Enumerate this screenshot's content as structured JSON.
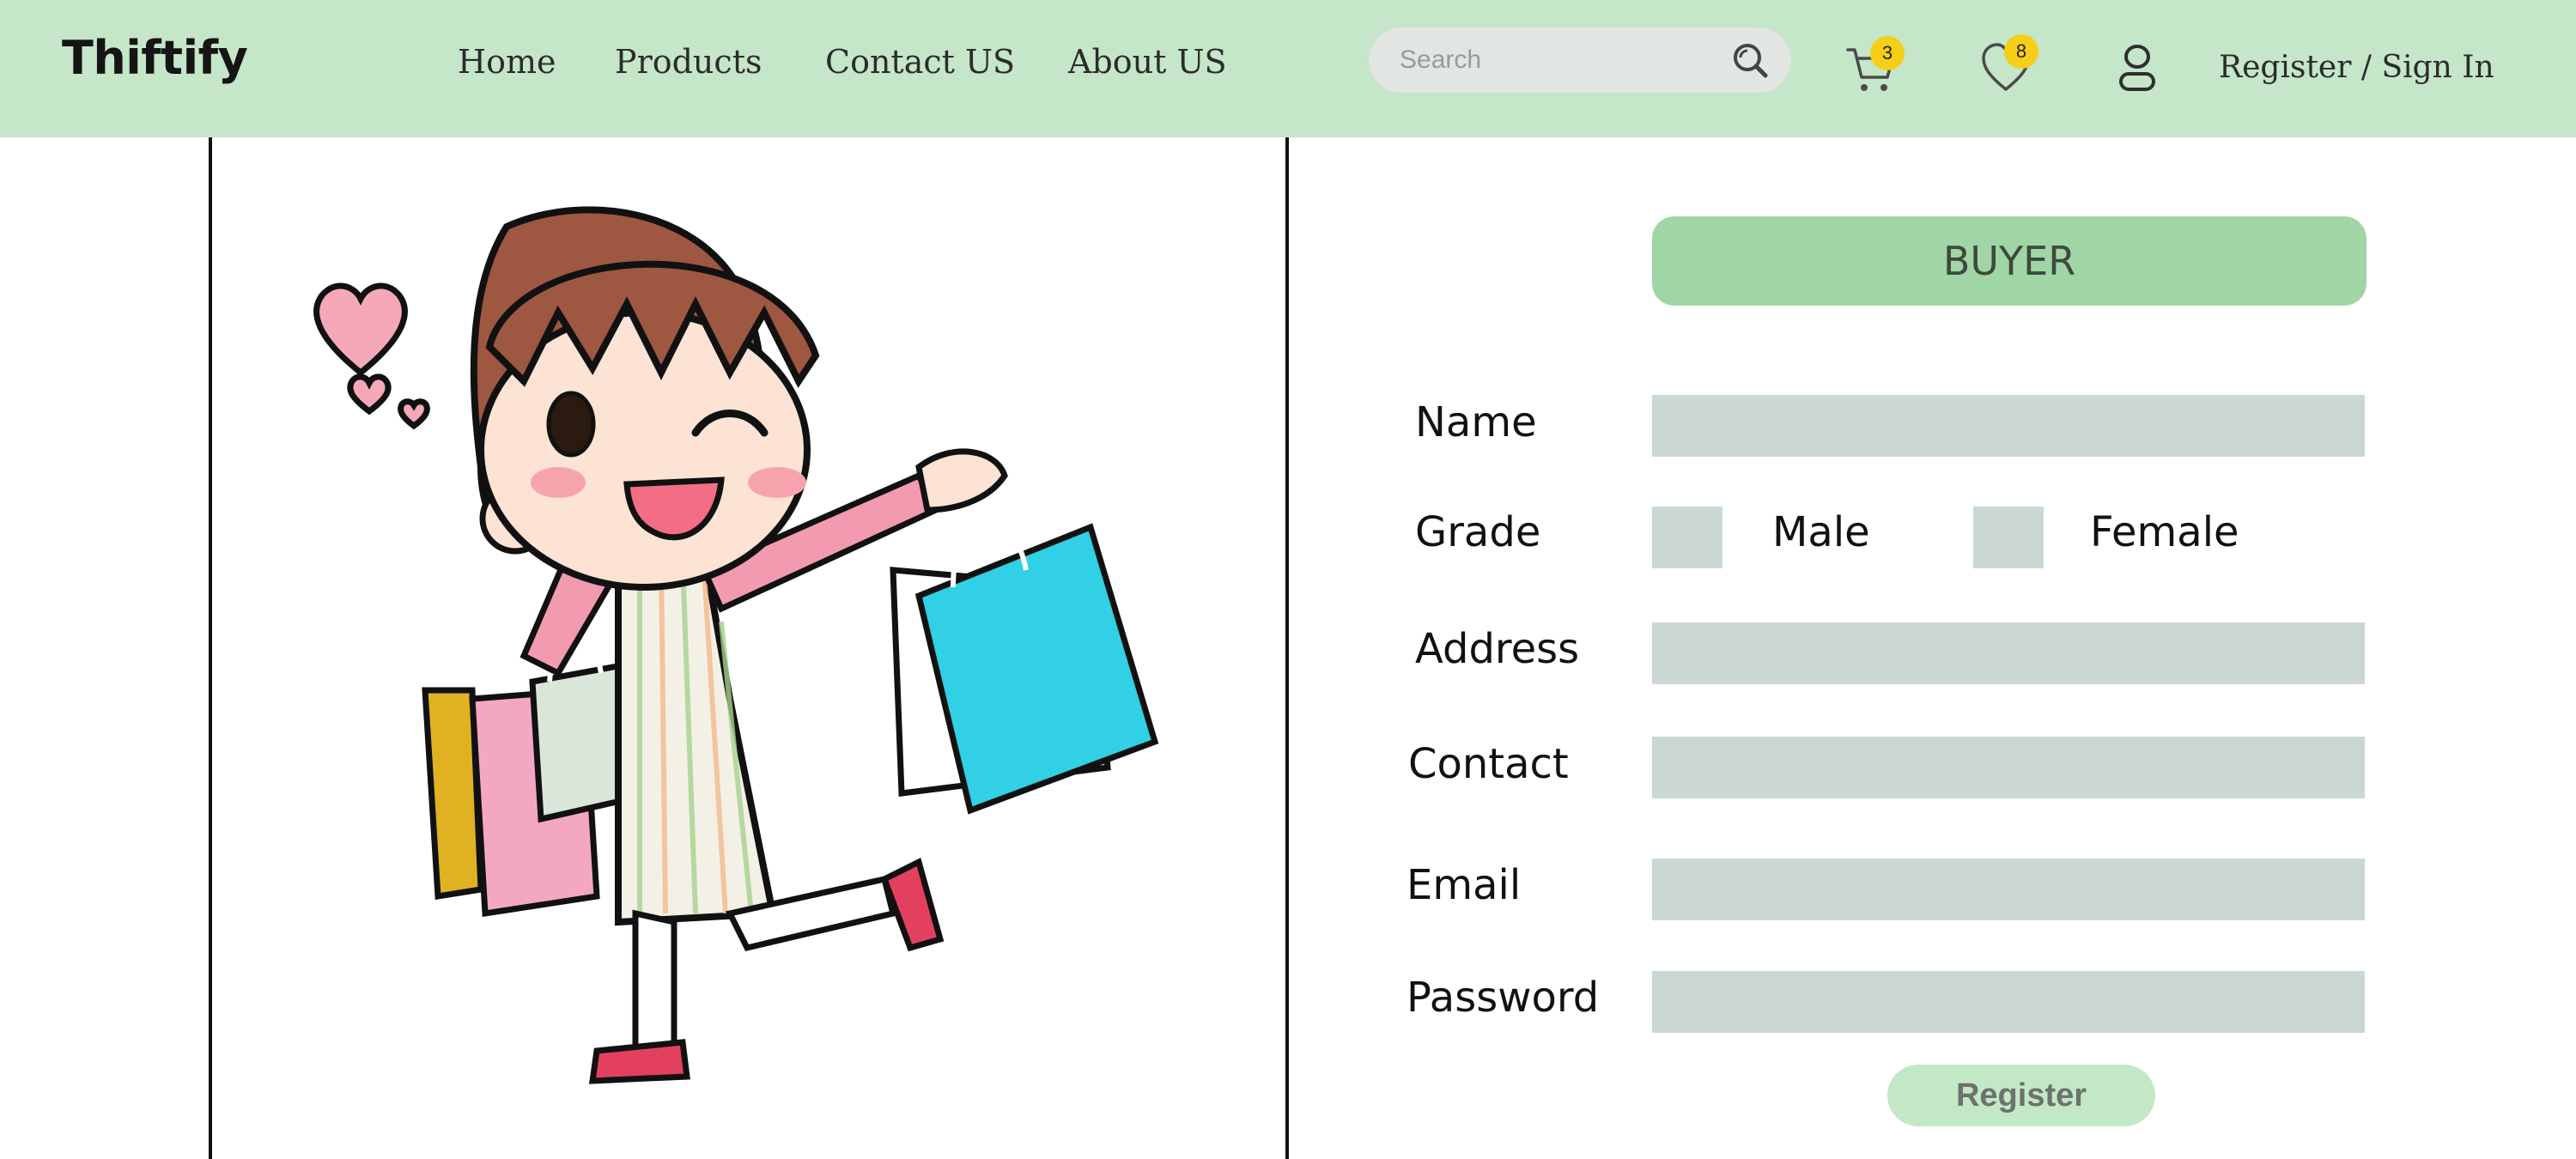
{
  "header": {
    "logo": "Thiftify",
    "nav": [
      {
        "label": "Home"
      },
      {
        "label": "Products"
      },
      {
        "label": "Contact US"
      },
      {
        "label": "About US"
      }
    ],
    "search": {
      "placeholder": "Search",
      "value": "",
      "icon": "search-icon"
    },
    "cart": {
      "icon": "cart-icon",
      "count": "3"
    },
    "wishlist": {
      "icon": "heart-icon",
      "count": "8"
    },
    "account": {
      "icon": "user-icon"
    },
    "auth_link": "Register / Sign In"
  },
  "illustration": {
    "subject": "cartoon girl with shopping bags"
  },
  "form": {
    "role": "BUYER",
    "fields": [
      {
        "label": "Name",
        "value": ""
      },
      {
        "label": "Address",
        "value": ""
      },
      {
        "label": "Contact",
        "value": ""
      },
      {
        "label": "Email",
        "value": ""
      },
      {
        "label": "Password",
        "value": ""
      }
    ],
    "grade": {
      "label": "Grade",
      "options": [
        {
          "label": "Male",
          "checked": false
        },
        {
          "label": "Female",
          "checked": false
        }
      ]
    },
    "submit_label": "Register"
  },
  "colors": {
    "header_bg": "#c5e6c8",
    "banner_bg": "#a0d5a6",
    "input_bg": "#cbd7d5",
    "badge": "#f6ce17",
    "button_bg": "#c3e8c6"
  }
}
